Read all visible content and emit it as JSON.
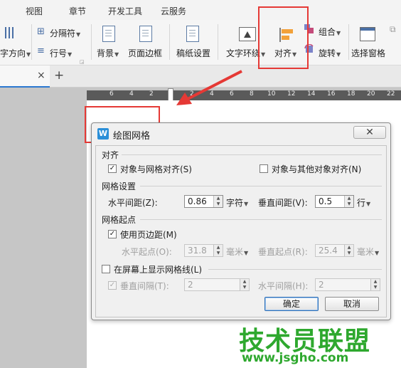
{
  "menubar": {
    "items": [
      "视图",
      "章节",
      "开发工具",
      "云服务"
    ]
  },
  "ribbon": {
    "text_direction": "字方向",
    "separator": "分隔符",
    "line_number": "行号",
    "background": "背景",
    "page_border": "页面边框",
    "manuscript": "稿纸设置",
    "text_wrap": "文字环绕",
    "align": "对齐",
    "group": "组合",
    "rotate": "旋转",
    "selection_pane": "选择窗格"
  },
  "tabs": {
    "close": "×",
    "new": "+"
  },
  "ruler": {
    "ticks": [
      "6",
      "4",
      "2",
      "2",
      "4",
      "6",
      "8",
      "10",
      "12",
      "14",
      "16",
      "18",
      "20",
      "22"
    ]
  },
  "dialog": {
    "icon": "W",
    "title": "绘图网格",
    "close": "✕",
    "section_align": "对齐",
    "snap_to_grid": "对象与网格对齐(S)",
    "snap_to_grid_checked": true,
    "snap_to_objects": "对象与其他对象对齐(N)",
    "snap_to_objects_checked": false,
    "section_grid": "网格设置",
    "h_spacing_label": "水平间距(Z):",
    "h_spacing_value": "0.86",
    "h_spacing_unit": "字符",
    "v_spacing_label": "垂直间距(V):",
    "v_spacing_value": "0.5",
    "v_spacing_unit": "行",
    "section_origin": "网格起点",
    "use_margins": "使用页边距(M)",
    "use_margins_checked": true,
    "h_origin_label": "水平起点(O):",
    "h_origin_value": "31.8",
    "h_origin_unit": "毫米",
    "v_origin_label": "垂直起点(R):",
    "v_origin_value": "25.4",
    "v_origin_unit": "毫米",
    "show_gridlines": "在屏幕上显示网格线(L)",
    "show_gridlines_checked": false,
    "v_interval_label": "垂直间隔(T):",
    "v_interval_value": "2",
    "v_interval_checked": true,
    "h_interval_label": "水平间隔(H):",
    "h_interval_value": "2",
    "ok": "确定",
    "cancel": "取消"
  },
  "watermark": {
    "main": "技术员联盟",
    "url": "www.jsgho.com"
  },
  "colors": {
    "highlight": "#e53935",
    "watermark": "#2ea82e"
  }
}
